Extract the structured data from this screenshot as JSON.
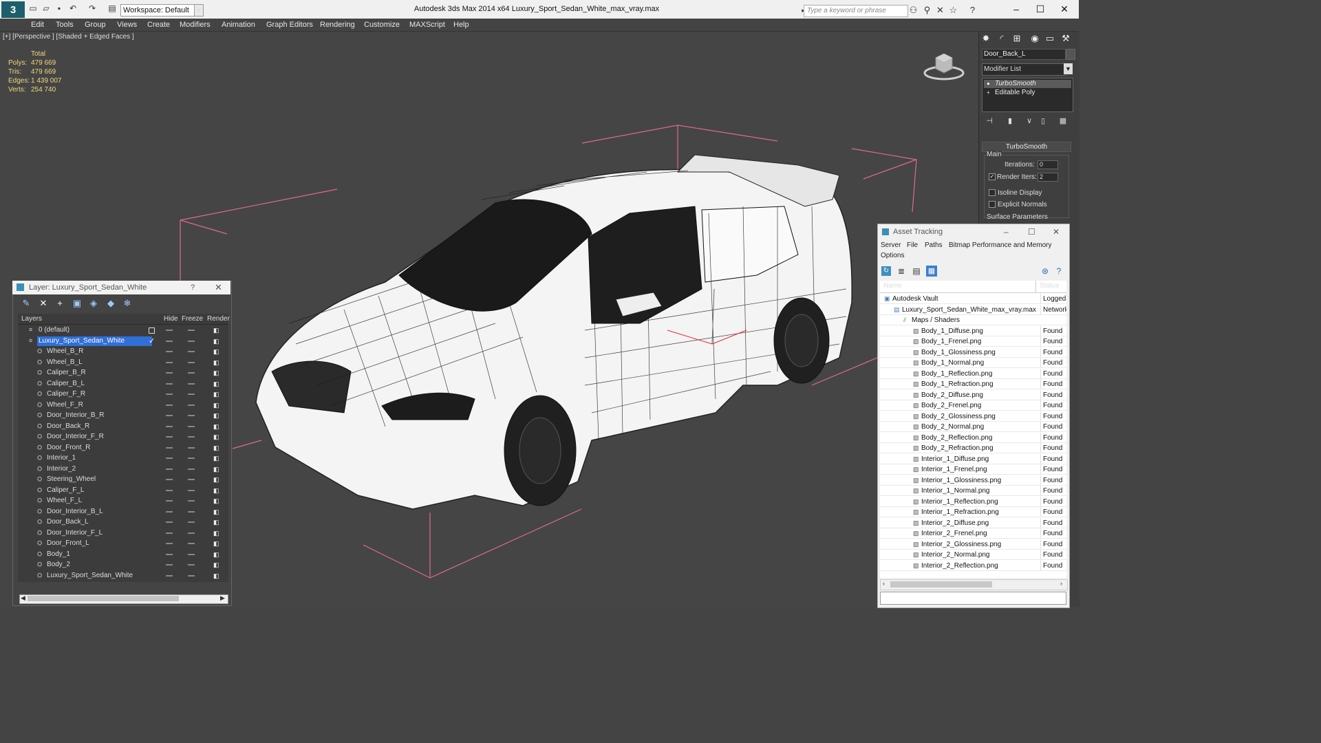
{
  "titlebar": {
    "workspace_label": "Workspace: Default",
    "app_title": "Autodesk 3ds Max  2014 x64      Luxury_Sport_Sedan_White_max_vray.max",
    "search_placeholder": "Type a keyword or phrase"
  },
  "menu": [
    "Edit",
    "Tools",
    "Group",
    "Views",
    "Create",
    "Modifiers",
    "Animation",
    "Graph Editors",
    "Rendering",
    "Customize",
    "MAXScript",
    "Help"
  ],
  "viewport": {
    "label": "[+] [Perspective ] [Shaded + Edged Faces ]",
    "stats": {
      "total_label": "Total",
      "rows": [
        {
          "label": "Polys:",
          "value": "479 669"
        },
        {
          "label": "Tris:",
          "value": "479 669"
        },
        {
          "label": "Edges:",
          "value": "1 439 007"
        },
        {
          "label": "Verts:",
          "value": "254 740"
        }
      ]
    }
  },
  "command_panel": {
    "object_name": "Door_Back_L",
    "modifier_list": "Modifier List",
    "stack": [
      "TurboSmooth",
      "Editable Poly"
    ],
    "rollout_title": "TurboSmooth",
    "main_label": "Main",
    "iterations_label": "Iterations:",
    "iterations_value": "0",
    "render_iters_label": "Render Iters:",
    "render_iters_value": "2",
    "isoline_label": "Isoline Display",
    "explicit_normals_label": "Explicit Normals",
    "surface_params_label": "Surface Parameters"
  },
  "layer_window": {
    "title": "Layer: Luxury_Sport_Sedan_White",
    "help": "?",
    "columns": [
      "Layers",
      "Hide",
      "Freeze",
      "Render"
    ],
    "rows": [
      {
        "name": "0 (default)",
        "level": 1,
        "kind": "layer"
      },
      {
        "name": "Luxury_Sport_Sedan_White",
        "level": 1,
        "kind": "layer",
        "selected": true
      },
      {
        "name": "Wheel_B_R",
        "level": 2,
        "kind": "object"
      },
      {
        "name": "Wheel_B_L",
        "level": 2,
        "kind": "object"
      },
      {
        "name": "Caliper_B_R",
        "level": 2,
        "kind": "object"
      },
      {
        "name": "Caliper_B_L",
        "level": 2,
        "kind": "object"
      },
      {
        "name": "Caliper_F_R",
        "level": 2,
        "kind": "object"
      },
      {
        "name": "Wheel_F_R",
        "level": 2,
        "kind": "object"
      },
      {
        "name": "Door_Interior_B_R",
        "level": 2,
        "kind": "object"
      },
      {
        "name": "Door_Back_R",
        "level": 2,
        "kind": "object"
      },
      {
        "name": "Door_Interior_F_R",
        "level": 2,
        "kind": "object"
      },
      {
        "name": "Door_Front_R",
        "level": 2,
        "kind": "object"
      },
      {
        "name": "Interior_1",
        "level": 2,
        "kind": "object"
      },
      {
        "name": "Interior_2",
        "level": 2,
        "kind": "object"
      },
      {
        "name": "Steering_Wheel",
        "level": 2,
        "kind": "object"
      },
      {
        "name": "Caliper_F_L",
        "level": 2,
        "kind": "object"
      },
      {
        "name": "Wheel_F_L",
        "level": 2,
        "kind": "object"
      },
      {
        "name": "Door_Interior_B_L",
        "level": 2,
        "kind": "object"
      },
      {
        "name": "Door_Back_L",
        "level": 2,
        "kind": "object"
      },
      {
        "name": "Door_Interior_F_L",
        "level": 2,
        "kind": "object"
      },
      {
        "name": "Door_Front_L",
        "level": 2,
        "kind": "object"
      },
      {
        "name": "Body_1",
        "level": 2,
        "kind": "object"
      },
      {
        "name": "Body_2",
        "level": 2,
        "kind": "object"
      },
      {
        "name": "Luxury_Sport_Sedan_White",
        "level": 2,
        "kind": "object"
      }
    ]
  },
  "asset_window": {
    "title": "Asset Tracking",
    "menus": [
      "Server",
      "File",
      "Paths",
      "Bitmap Performance and Memory",
      "Options"
    ],
    "columns": [
      "Name",
      "Status"
    ],
    "rows": [
      {
        "name": "Autodesk Vault",
        "status": "Logged C",
        "level": 0
      },
      {
        "name": "Luxury_Sport_Sedan_White_max_vray.max",
        "status": "Network",
        "level": 1
      },
      {
        "name": "Maps / Shaders",
        "status": "",
        "level": 2
      },
      {
        "name": "Body_1_Diffuse.png",
        "status": "Found",
        "level": 3
      },
      {
        "name": "Body_1_Frenel.png",
        "status": "Found",
        "level": 3
      },
      {
        "name": "Body_1_Glossiness.png",
        "status": "Found",
        "level": 3
      },
      {
        "name": "Body_1_Normal.png",
        "status": "Found",
        "level": 3
      },
      {
        "name": "Body_1_Reflection.png",
        "status": "Found",
        "level": 3
      },
      {
        "name": "Body_1_Refraction.png",
        "status": "Found",
        "level": 3
      },
      {
        "name": "Body_2_Diffuse.png",
        "status": "Found",
        "level": 3
      },
      {
        "name": "Body_2_Frenel.png",
        "status": "Found",
        "level": 3
      },
      {
        "name": "Body_2_Glossiness.png",
        "status": "Found",
        "level": 3
      },
      {
        "name": "Body_2_Normal.png",
        "status": "Found",
        "level": 3
      },
      {
        "name": "Body_2_Reflection.png",
        "status": "Found",
        "level": 3
      },
      {
        "name": "Body_2_Refraction.png",
        "status": "Found",
        "level": 3
      },
      {
        "name": "Interior_1_Diffuse.png",
        "status": "Found",
        "level": 3
      },
      {
        "name": "Interior_1_Frenel.png",
        "status": "Found",
        "level": 3
      },
      {
        "name": "Interior_1_Glossiness.png",
        "status": "Found",
        "level": 3
      },
      {
        "name": "Interior_1_Normal.png",
        "status": "Found",
        "level": 3
      },
      {
        "name": "Interior_1_Reflection.png",
        "status": "Found",
        "level": 3
      },
      {
        "name": "Interior_1_Refraction.png",
        "status": "Found",
        "level": 3
      },
      {
        "name": "Interior_2_Diffuse.png",
        "status": "Found",
        "level": 3
      },
      {
        "name": "Interior_2_Frenel.png",
        "status": "Found",
        "level": 3
      },
      {
        "name": "Interior_2_Glossiness.png",
        "status": "Found",
        "level": 3
      },
      {
        "name": "Interior_2_Normal.png",
        "status": "Found",
        "level": 3
      },
      {
        "name": "Interior_2_Reflection.png",
        "status": "Found",
        "level": 3
      }
    ]
  },
  "colors": {
    "viewport_bg": "#454545",
    "stats_text": "#f0d77a",
    "selection_blue": "#2f6fd6",
    "bounding_box": "#e06a8a"
  }
}
